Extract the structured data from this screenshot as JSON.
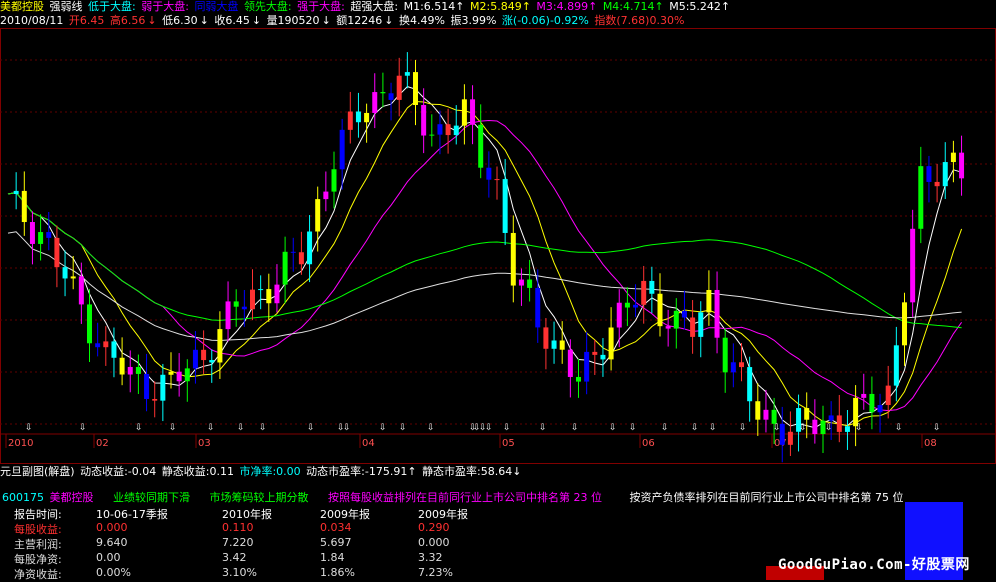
{
  "header": {
    "stock_name": "美都控股",
    "indicator": "强弱线",
    "items": [
      {
        "label": "低于大盘:",
        "color": "#00ffff"
      },
      {
        "label": "弱于大盘:",
        "color": "#ff00ff"
      },
      {
        "label": "同弱大盘",
        "color": "#0000ff"
      },
      {
        "label": "领先大盘:",
        "color": "#00ff00"
      },
      {
        "label": "强于大盘:",
        "color": "#ff00ff"
      },
      {
        "label": "超强大盘:",
        "color": "#ffffff"
      }
    ],
    "ma": [
      {
        "label": "M1:6.514",
        "arrow": "↑",
        "color": "#ffffff"
      },
      {
        "label": "M2:5.849",
        "arrow": "↑",
        "color": "#ffff00"
      },
      {
        "label": "M3:4.899",
        "arrow": "↑",
        "color": "#ff00ff"
      },
      {
        "label": "M4:4.714",
        "arrow": "↑",
        "color": "#00ff00"
      },
      {
        "label": "M5:5.242",
        "arrow": "↑",
        "color": "#ffffff"
      }
    ]
  },
  "quote": {
    "date": "2010/08/11",
    "open": "开6.45",
    "high": "高6.56",
    "low": "低6.30",
    "close": "收6.45",
    "volume": "量190520",
    "amount": "额12246",
    "turnover": "换4.49%",
    "amplitude": "振3.99%",
    "change": "涨(-0.06)-0.92%",
    "index": "指数(7.68)0.30%"
  },
  "timeline": {
    "labels": [
      "2010",
      "02",
      "03",
      "04",
      "05",
      "06",
      "07",
      "08"
    ]
  },
  "sub_header": {
    "title": "元旦副图(解盘)",
    "dynamic_income": "动态收益:-0.04",
    "static_income": "静态收益:0.11",
    "market_rate": "市净率:0.00",
    "dynamic_pe": "动态市盈率:-175.91",
    "dynamic_pe_arrow": "↑",
    "static_pe": "静态市盈率:58.64",
    "static_pe_arrow": "↓"
  },
  "info": {
    "code": "600175",
    "name": "美都控股",
    "performance": "业绩较同期下滑",
    "chip": "市场筹码较上期分散",
    "eps_rank": "按照每股收益排列在目前同行业上市公司中排名第 23 位",
    "debt_rank": "按资产负债率排列在目前同行业上市公司中排名第 75 位"
  },
  "table": {
    "headers": [
      "报告时间:",
      "10-06-17季报",
      "2010年报",
      "2009年报",
      "2009年报"
    ],
    "rows": [
      {
        "label": "每股收益:",
        "values": [
          "0.000",
          "0.110",
          "0.034",
          "0.290"
        ],
        "label_color": "#ff3030",
        "value_color": "#ff3030"
      },
      {
        "label": "主营利润:",
        "values": [
          "9.640",
          "7.220",
          "5.697",
          "0.000"
        ],
        "label_color": "#dddddd",
        "value_color": "#dddddd"
      },
      {
        "label": "每股净资:",
        "values": [
          "0.00",
          "3.42",
          "1.84",
          "3.32"
        ],
        "label_color": "#dddddd",
        "value_color": "#dddddd"
      },
      {
        "label": "净资收益:",
        "values": [
          "0.00%",
          "3.10%",
          "1.86%",
          "7.23%"
        ],
        "label_color": "#dddddd",
        "value_color": "#dddddd"
      }
    ]
  },
  "watermark": "GoodGuPiao.Com-好股票网",
  "colors": {
    "up": "#ff3232",
    "down": "#00ffff",
    "grid": "#800000",
    "yellow": "#ffff00",
    "magenta": "#ff00ff",
    "green": "#00ff00",
    "white": "#ffffff",
    "blue": "#0000ff"
  }
}
